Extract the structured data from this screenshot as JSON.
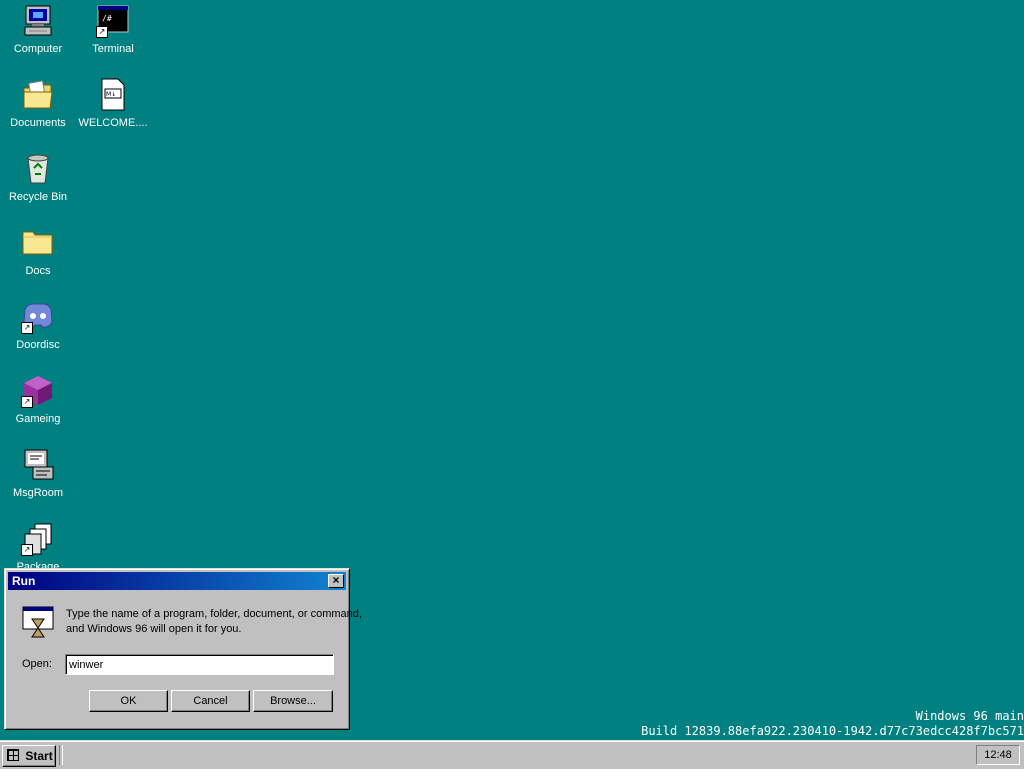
{
  "desktop": {
    "icons": [
      {
        "label": "Computer",
        "icon": "computer-icon"
      },
      {
        "label": "Terminal",
        "icon": "terminal-icon"
      },
      {
        "label": "Documents",
        "icon": "documents-folder-icon"
      },
      {
        "label": "WELCOME....",
        "icon": "markdown-file-icon"
      },
      {
        "label": "Recycle Bin",
        "icon": "recycle-bin-icon"
      },
      {
        "label": "Docs",
        "icon": "folder-icon"
      },
      {
        "label": "Doordisc",
        "icon": "discord-icon"
      },
      {
        "label": "Gameing",
        "icon": "game-cube-icon"
      },
      {
        "label": "MsgRoom",
        "icon": "msgroom-icon"
      },
      {
        "label": "Package",
        "icon": "package-icon"
      }
    ],
    "build_line1": "Windows 96 main",
    "build_line2": "Build 12839.88efa922.230410-1942.d77c73edcc428f7bc571"
  },
  "run_dialog": {
    "title": "Run",
    "description_line1": "Type the name of a program, folder, document, or command,",
    "description_line2": "and Windows 96 will open it for you.",
    "open_label": "Open:",
    "open_value": "winwer",
    "ok_label": "OK",
    "cancel_label": "Cancel",
    "browse_label": "Browse..."
  },
  "taskbar": {
    "start_label": "Start",
    "clock": "12:48"
  },
  "colors": {
    "desktop": "#008080",
    "titlebar_start": "#000080",
    "titlebar_end": "#1084d0",
    "face": "#c0c0c0"
  }
}
